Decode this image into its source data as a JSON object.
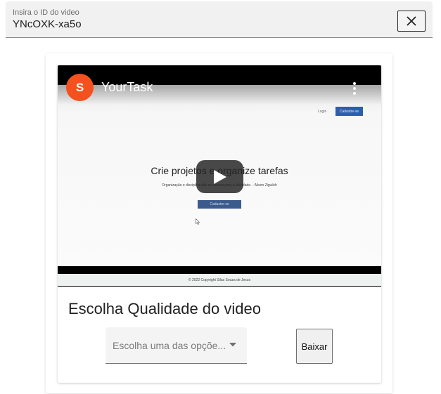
{
  "id_input": {
    "label": "Insira o ID do video",
    "value": "YNcOXK-xa5o",
    "clear_icon": "close-icon"
  },
  "video": {
    "channel_initial": "S",
    "title": "YourTask",
    "more_icon": "more-vert-icon",
    "play_icon": "play-icon",
    "preview": {
      "login": "Login",
      "signup": "Cadastre-se",
      "headline": "Crie projetos e organize tarefas",
      "subtext": "Organização e disciplina são as chaves para a felicidade. - Alison Ziguilch",
      "cta": "Cadastre-se",
      "footer": "© 2022 Copyright Silas Souza de Jesus"
    }
  },
  "quality": {
    "heading": "Escolha Qualidade do video",
    "select_placeholder": "Escolha uma das opçõe...",
    "dropdown_icon": "chevron-down-icon",
    "download_label": "Baixar"
  },
  "colors": {
    "avatar": "#f4511e",
    "page_background": "#ffffff",
    "input_background": "#f1f1f1"
  }
}
